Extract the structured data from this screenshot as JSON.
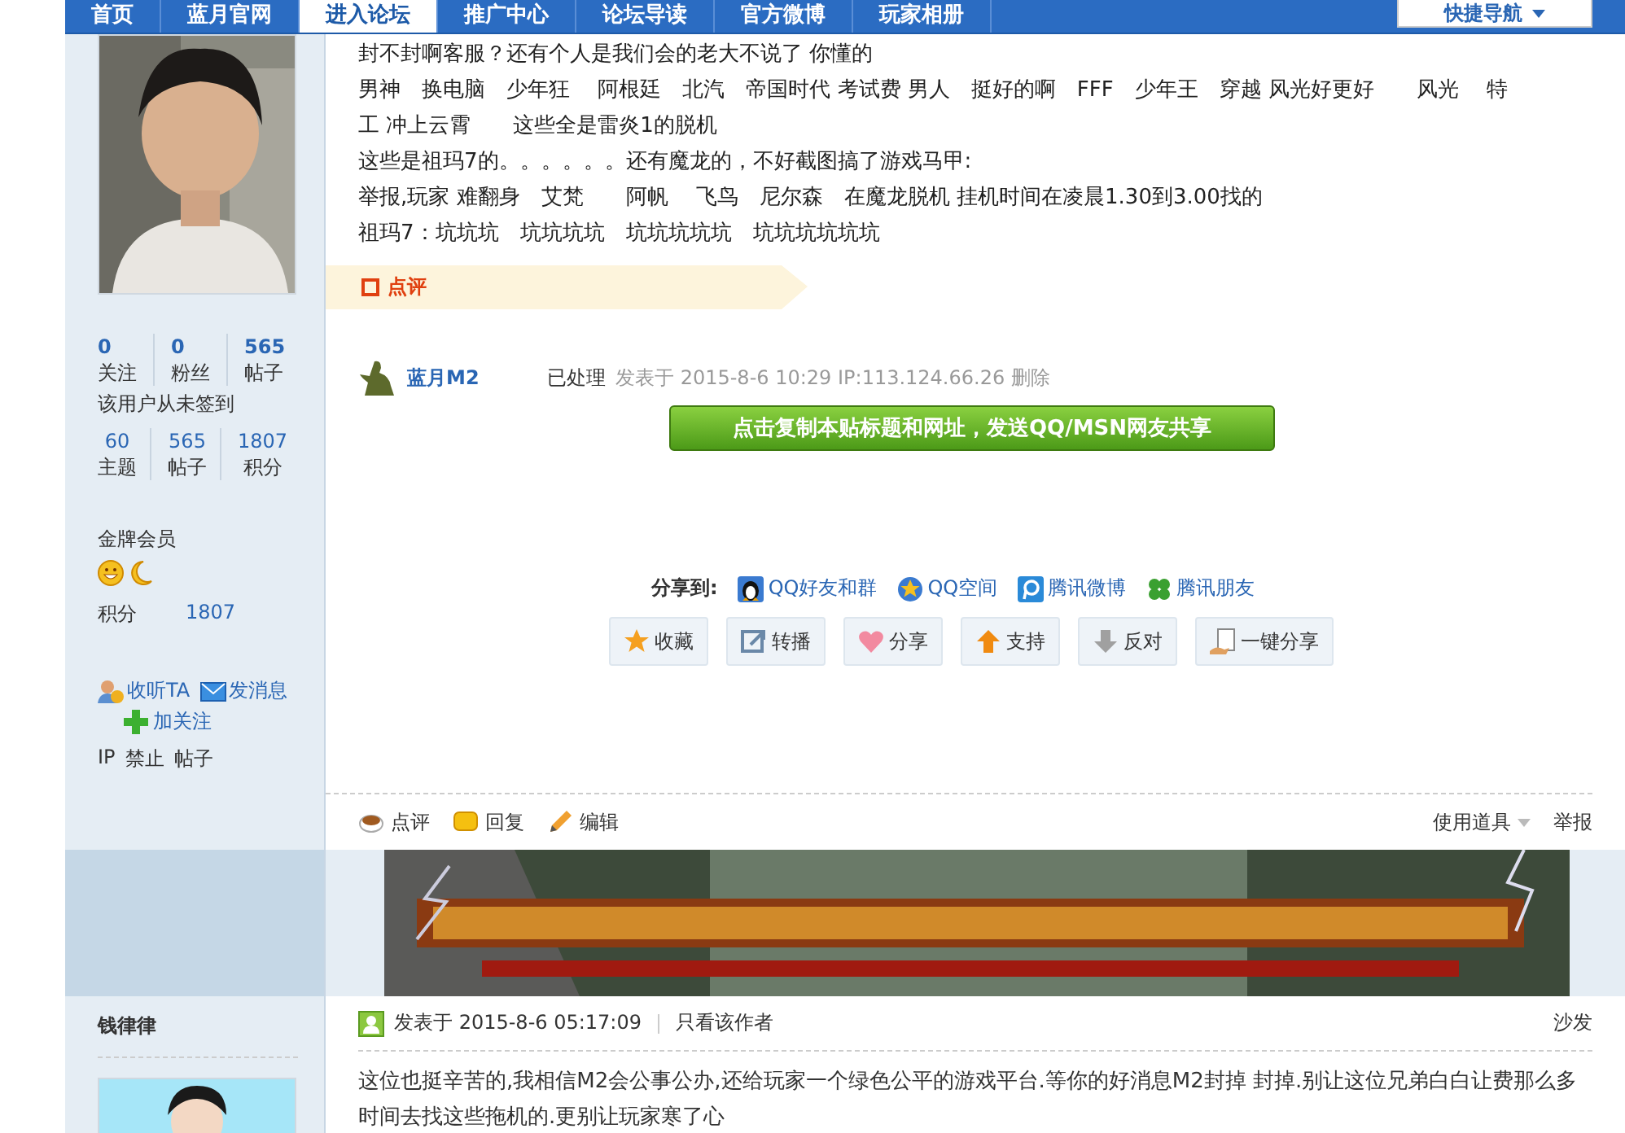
{
  "nav": {
    "tabs": [
      {
        "label": "首页",
        "selected": false
      },
      {
        "label": "蓝月官网",
        "selected": false
      },
      {
        "label": "进入论坛",
        "selected": true
      },
      {
        "label": "推广中心",
        "selected": false
      },
      {
        "label": "论坛导读",
        "selected": false
      },
      {
        "label": "官方微博",
        "selected": false
      },
      {
        "label": "玩家相册",
        "selected": false
      }
    ],
    "quick_nav": "快捷导航"
  },
  "author": {
    "stats": [
      {
        "value": "0",
        "label": "关注"
      },
      {
        "value": "0",
        "label": "粉丝"
      },
      {
        "value": "565",
        "label": "帖子"
      }
    ],
    "sign_note": "该用户从未签到",
    "stats2": [
      {
        "value": "60",
        "label": "主题"
      },
      {
        "value": "565",
        "label": "帖子"
      },
      {
        "value": "1807",
        "label": "积分"
      }
    ],
    "rank": "金牌会员",
    "points_label": "积分",
    "points_value": "1807",
    "actions": [
      "收听TA",
      "发消息",
      "加关注"
    ],
    "admin_links": [
      "IP",
      "禁止",
      "帖子"
    ]
  },
  "post": {
    "lines": [
      "封不封啊客服？还有个人是我们会的老大不说了 你懂的",
      "男神　换电脑　少年狂　 阿根廷　北汽　帝国时代 考试费 男人　挺好的啊　FFF　少年王　穿越 风光好更好　　风光　 特工 冲上云霄　　这些全是雷炎1的脱机",
      "这些是祖玛7的。。。。。。还有魔龙的，不好截图搞了游戏马甲:",
      "举报,玩家 难翻身　艾梵　　阿帆　 飞鸟　尼尔森　在魔龙脱机 挂机时间在凌晨1.30到3.00找的",
      "祖玛7：坑坑坑　坑坑坑坑　坑坑坑坑坑　坑坑坑坑坑坑"
    ],
    "comment_tab": "点评",
    "review": {
      "name": "蓝月M2",
      "status": "已处理",
      "posted": "发表于 2015-8-6 10:29 IP:113.124.66.26",
      "delete": "删除"
    },
    "copy_button": "点击复制本贴标题和网址，发送QQ/MSN网友共享",
    "share_label": "分享到:",
    "share_targets": [
      "QQ好友和群",
      "QQ空间",
      "腾讯微博",
      "腾讯朋友"
    ],
    "buttons": [
      "收藏",
      "转播",
      "分享",
      "支持",
      "反对",
      "一键分享"
    ],
    "actions": [
      "点评",
      "回复",
      "编辑"
    ],
    "tools": "使用道具",
    "report": "举报"
  },
  "reply": {
    "author": "钱律律",
    "posted": "发表于 2015-8-6 05:17:09",
    "only_author": "只看该作者",
    "floor": "沙发",
    "body": "这位也挺辛苦的,我相信M2会公事公办,还给玩家一个绿色公平的游戏平台.等你的好消息M2封掉 封掉.别让这位兄弟白白让费那么多时间去找这些拖机的.更别让玩家寒了心"
  }
}
